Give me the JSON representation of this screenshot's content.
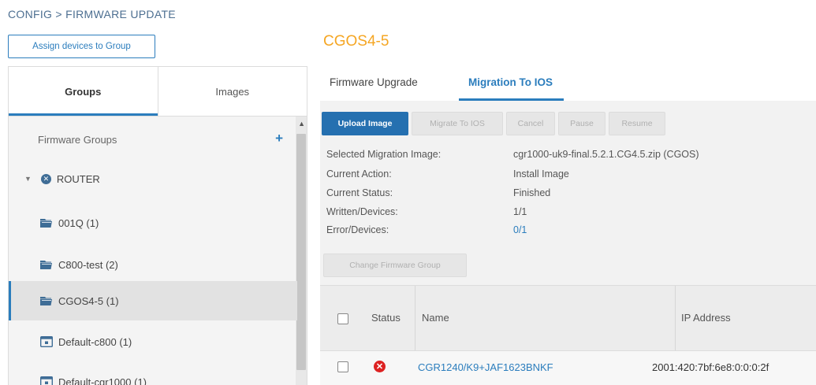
{
  "breadcrumb": "CONFIG > FIRMWARE UPDATE",
  "assign_button": "Assign devices to Group",
  "side_tabs": {
    "groups": "Groups",
    "images": "Images"
  },
  "sidebar": {
    "heading": "Firmware Groups",
    "add_symbol": "+",
    "router_label": "ROUTER",
    "groups": [
      {
        "label": "001Q (1)"
      },
      {
        "label": "C800-test (2)"
      },
      {
        "label": "CGOS4-5 (1)",
        "selected": true
      },
      {
        "label": "Default-c800 (1)"
      },
      {
        "label": "Default-cgr1000 (1)"
      }
    ]
  },
  "group_title": "CGOS4-5",
  "main_tabs": {
    "upgrade": "Firmware Upgrade",
    "migration": "Migration To IOS"
  },
  "toolbar": {
    "upload": "Upload Image",
    "migrate": "Migrate To IOS",
    "cancel": "Cancel",
    "pause": "Pause",
    "resume": "Resume"
  },
  "info": {
    "selected_image_label": "Selected Migration Image:",
    "selected_image_value": "cgr1000-uk9-final.5.2.1.CG4.5.zip (CGOS)",
    "current_action_label": "Current Action:",
    "current_action_value": "Install Image",
    "current_status_label": "Current Status:",
    "current_status_value": "Finished",
    "written_label": "Written/Devices:",
    "written_value": "1/1",
    "error_label": "Error/Devices:",
    "error_value": "0/1"
  },
  "change_group_button": "Change Firmware Group",
  "grid": {
    "headers": {
      "status": "Status",
      "name": "Name",
      "ip": "IP Address"
    },
    "rows": [
      {
        "status": "error",
        "name": "CGR1240/K9+JAF1623BNKF",
        "ip": "2001:420:7bf:6e8:0:0:0:2f"
      }
    ]
  },
  "colors": {
    "accent": "#2b7dbd",
    "title": "#f5a623",
    "error": "#dd2222"
  }
}
